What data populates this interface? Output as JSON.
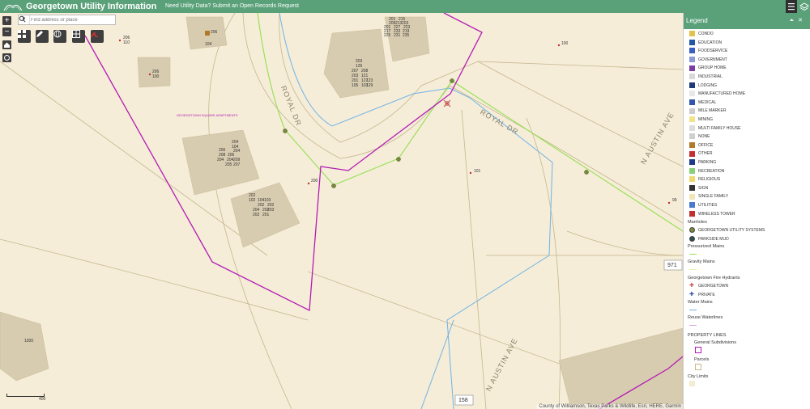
{
  "header": {
    "title": "Georgetown Utility Information",
    "notice": "Need Utility Data? Submit an Open Records Request"
  },
  "search": {
    "placeholder": "Find address or place"
  },
  "map": {
    "road_labels": {
      "royal_dr_1": "ROYAL DR",
      "royal_dr_2": "ROYAL DR",
      "n_austin_1": "N AUSTIN AVE",
      "n_austin_2": "N AUSTIN AVE"
    },
    "route_shields": [
      "971",
      "158"
    ],
    "apartments_label": "GEORGETOWN SQUARE APARTMENTS",
    "address_labels": [
      "206",
      "104",
      "206",
      "110",
      "206",
      "100",
      "100",
      "101",
      "200",
      "99",
      "1300",
      "201",
      "215",
      "209",
      "213",
      "203",
      "201",
      "227",
      "223",
      "217",
      "233",
      "219",
      "225",
      "231",
      "235",
      "203",
      "126",
      "207",
      "208",
      "203",
      "121",
      "201",
      "127",
      "123",
      "105",
      "103",
      "129",
      "204",
      "104",
      "206",
      "204",
      "208",
      "206",
      "204",
      "204",
      "209",
      "205",
      "207",
      "202",
      "102",
      "104",
      "103",
      "202",
      "202",
      "204",
      "202",
      "203",
      "202",
      "201"
    ],
    "scale_label": "400",
    "attribution": "County of Williamson, Texas Parks & Wildlife, Esri, HERE, Garmin"
  },
  "legend": {
    "title": "Legend",
    "point_items": [
      {
        "label": "CONDO",
        "color": "#e3c14b"
      },
      {
        "label": "EDUCATION",
        "color": "#2456a6"
      },
      {
        "label": "FOODSERVICE",
        "color": "#3b5fc0"
      },
      {
        "label": "GOVERNMENT",
        "color": "#8a9bd6"
      },
      {
        "label": "GROUP HOME",
        "color": "#7a3fa0"
      },
      {
        "label": "INDUSTRIAL",
        "color": "#d8d8d8"
      },
      {
        "label": "LODGING",
        "color": "#1e3a7a"
      },
      {
        "label": "MANUFACTURED HOME",
        "color": "#e8e8e8"
      },
      {
        "label": "MEDICAL",
        "color": "#3355aa"
      },
      {
        "label": "MILE MARKER",
        "color": "#cccccc"
      },
      {
        "label": "MINING",
        "color": "#f3e48a"
      },
      {
        "label": "MULTI FAMILY HOUSE",
        "color": "#dddddd"
      },
      {
        "label": "NONE",
        "color": "#cfcfcf"
      },
      {
        "label": "OFFICE",
        "color": "#b07a2a"
      },
      {
        "label": "OTHER",
        "color": "#c43030"
      },
      {
        "label": "PARKING",
        "color": "#1e3a8a"
      },
      {
        "label": "RECREATION",
        "color": "#8ad07a"
      },
      {
        "label": "RELIGIOUS",
        "color": "#f0d870"
      },
      {
        "label": "SIGN",
        "color": "#333333"
      },
      {
        "label": "SINGLE FAMILY",
        "color": "#f0e6b8"
      },
      {
        "label": "UTILITIES",
        "color": "#4a7ad0"
      },
      {
        "label": "WIRELESS TOWER",
        "color": "#c03030"
      }
    ],
    "manholes": {
      "heading": "Manholes",
      "items": [
        {
          "label": "GEORGETOWN UTILITY SYSTEMS",
          "color": "#7a8a3a"
        },
        {
          "label": "PARKSIDE MUD",
          "color": "#2f4f4f"
        }
      ]
    },
    "pressurized_mains": "Pressurized Mains",
    "gravity_mains": "Gravity Mains",
    "hydrants": {
      "heading": "Georgetown Fire Hydrants",
      "items": [
        {
          "label": "GEORGETOWN",
          "color": "#c0504d"
        },
        {
          "label": "PRIVATE",
          "color": "#2f4fa0"
        }
      ]
    },
    "water_mains": "Water Mains",
    "reuse_waterlines": "Reuse Waterlines",
    "property_lines": "PROPERTY LINES",
    "general_subdivisions": "General Subdivisions",
    "parcels": "Parcels",
    "city_limits": "City Limits",
    "colors": {
      "pressurized": "#9be05a",
      "gravity": "#e9f0a0",
      "water": "#6fb3e6",
      "reuse": "#d8a0d8",
      "subdivision": "#b41bb4",
      "parcel": "#c9b98a"
    }
  }
}
